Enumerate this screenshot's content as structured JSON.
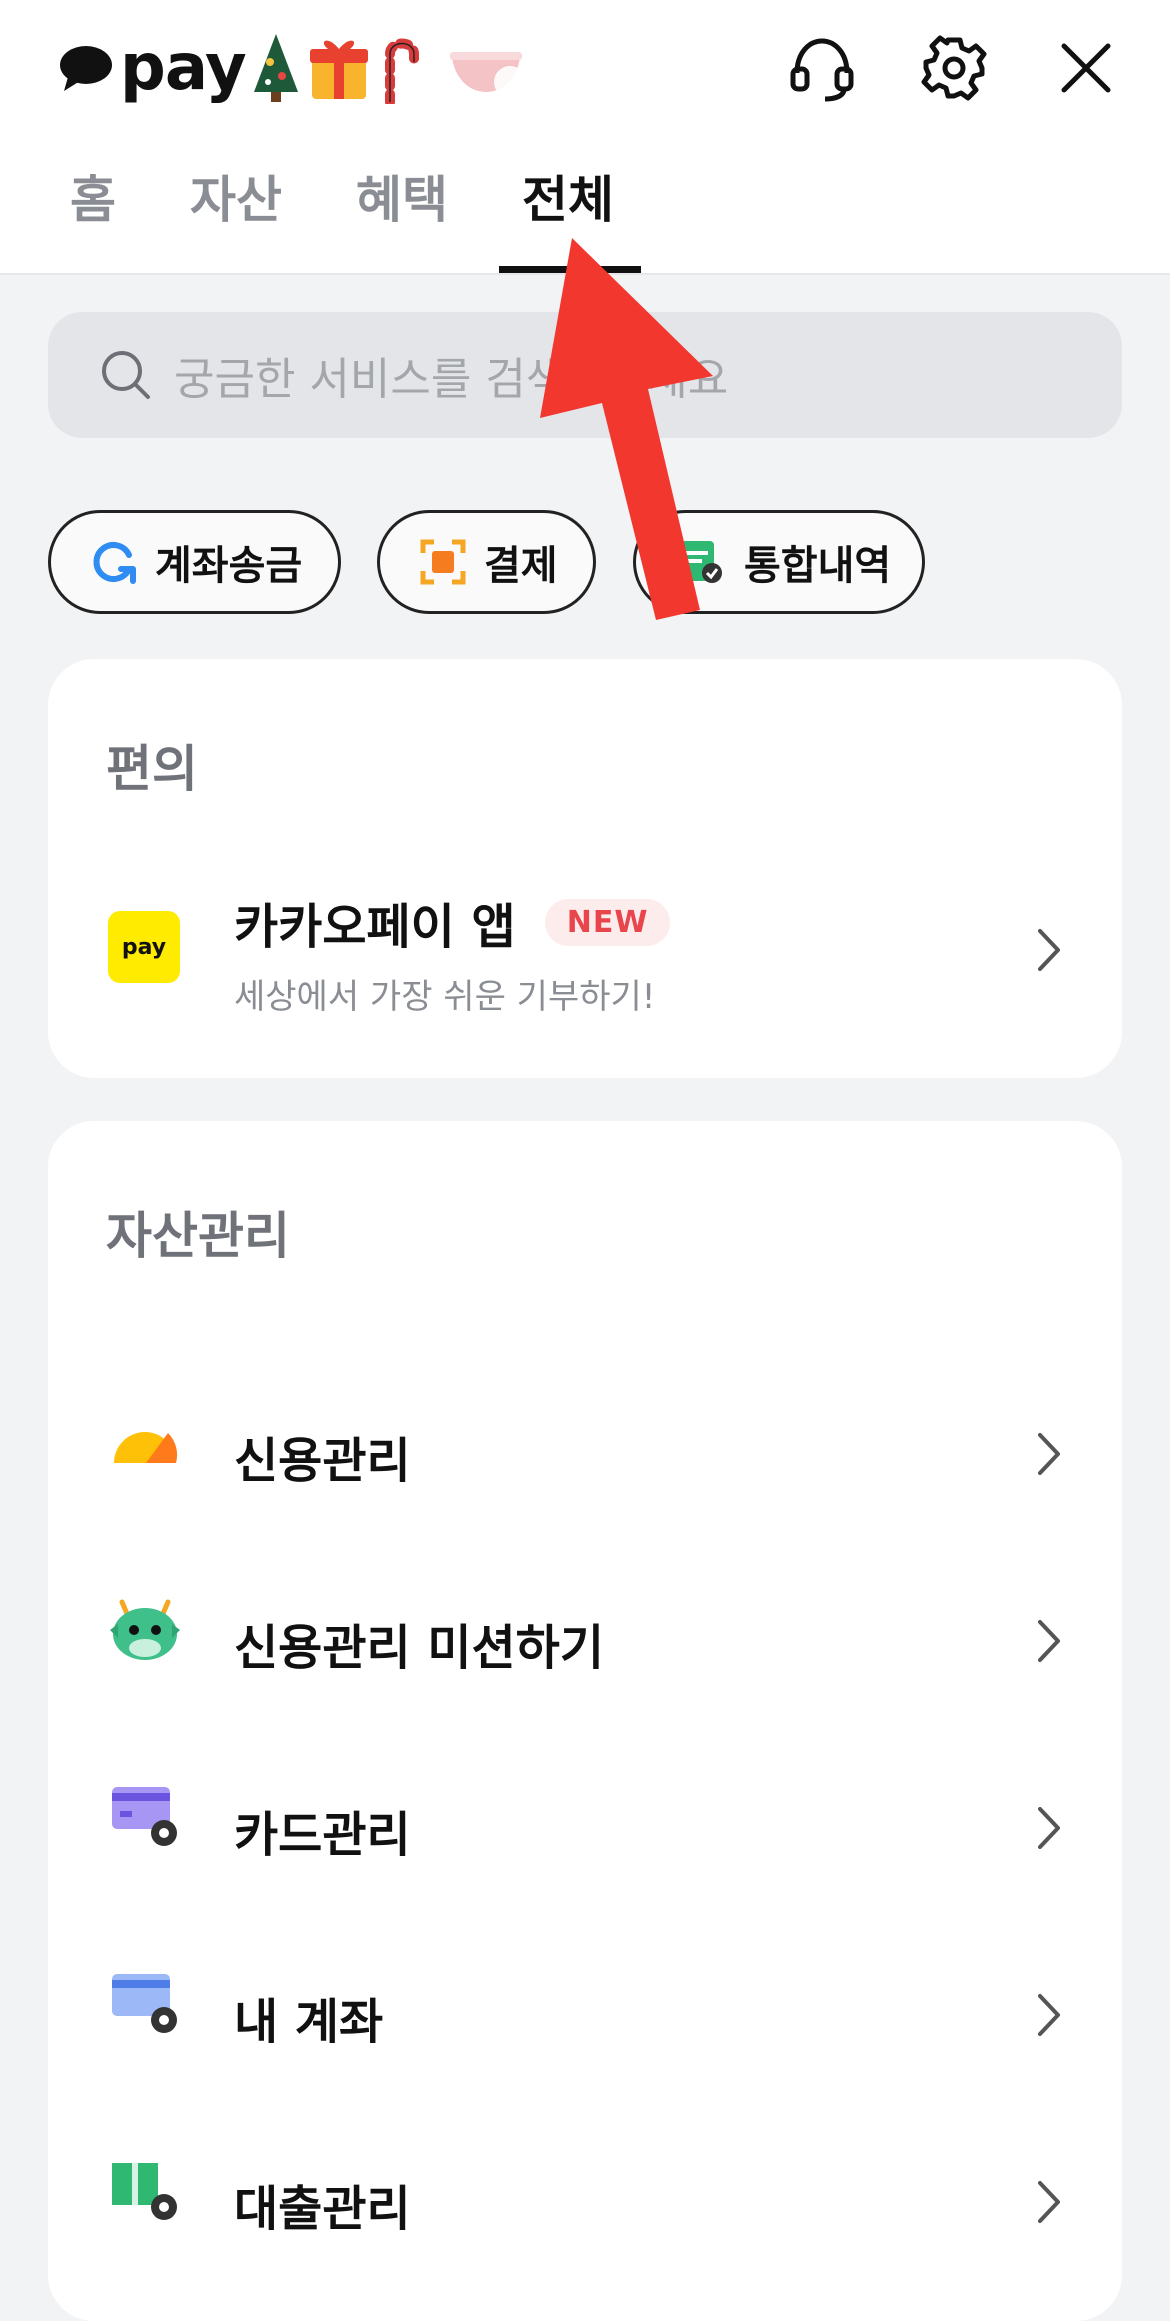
{
  "header": {
    "logo_text": "pay",
    "icons": [
      "headset-icon",
      "gear-icon",
      "close-icon"
    ]
  },
  "tabs": [
    {
      "label": "홈",
      "active": false
    },
    {
      "label": "자산",
      "active": false
    },
    {
      "label": "혜택",
      "active": false
    },
    {
      "label": "전체",
      "active": true
    }
  ],
  "search": {
    "placeholder": "궁금한 서비스를 검색해보세요"
  },
  "chips": [
    {
      "label": "계좌송금",
      "icon": "transfer-icon"
    },
    {
      "label": "결제",
      "icon": "scan-pay-icon"
    },
    {
      "label": "통합내역",
      "icon": "history-icon"
    }
  ],
  "sections": [
    {
      "title": "편의",
      "items": [
        {
          "label": "카카오페이 앱",
          "badge": "NEW",
          "sub": "세상에서 가장 쉬운 기부하기!",
          "icon_text": "pay",
          "icon": "kakaopay-app-icon"
        }
      ]
    },
    {
      "title": "자산관리",
      "items": [
        {
          "label": "신용관리",
          "icon": "credit-score-icon"
        },
        {
          "label": "신용관리 미션하기",
          "icon": "dragon-mission-icon"
        },
        {
          "label": "카드관리",
          "icon": "card-settings-icon"
        },
        {
          "label": "내 계좌",
          "icon": "account-settings-icon"
        },
        {
          "label": "대출관리",
          "icon": "loan-settings-icon"
        }
      ]
    }
  ],
  "colors": {
    "annotation_arrow": "#f2372f",
    "badge_text": "#e8464c",
    "kakao_yellow": "#ffeb00"
  }
}
